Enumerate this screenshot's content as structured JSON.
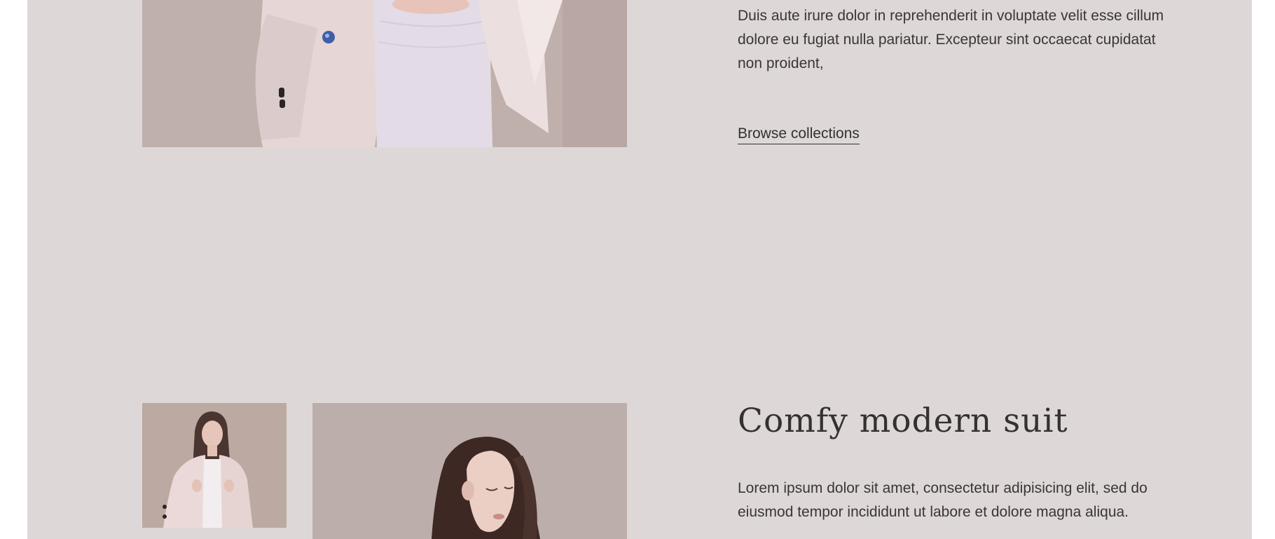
{
  "feature_top": {
    "image_alt": "",
    "description": "Duis aute irure dolor in reprehenderit in voluptate velit esse cillum dolore eu fugiat nulla pariatur. Excepteur sint occaecat cupidatat non proident,",
    "link_label": "Browse collections"
  },
  "feature_bottom": {
    "title": "Comfy modern suit",
    "description": "Lorem ipsum dolor sit amet, consectetur adipisicing elit, sed do eiusmod tempor incididunt ut labore et dolore magna aliqua."
  },
  "colors": {
    "page_background": "#ddd8d7",
    "text": "#3a3536",
    "photo_backdrop": "#bcaca7",
    "suit_color": "#ece0e0"
  }
}
